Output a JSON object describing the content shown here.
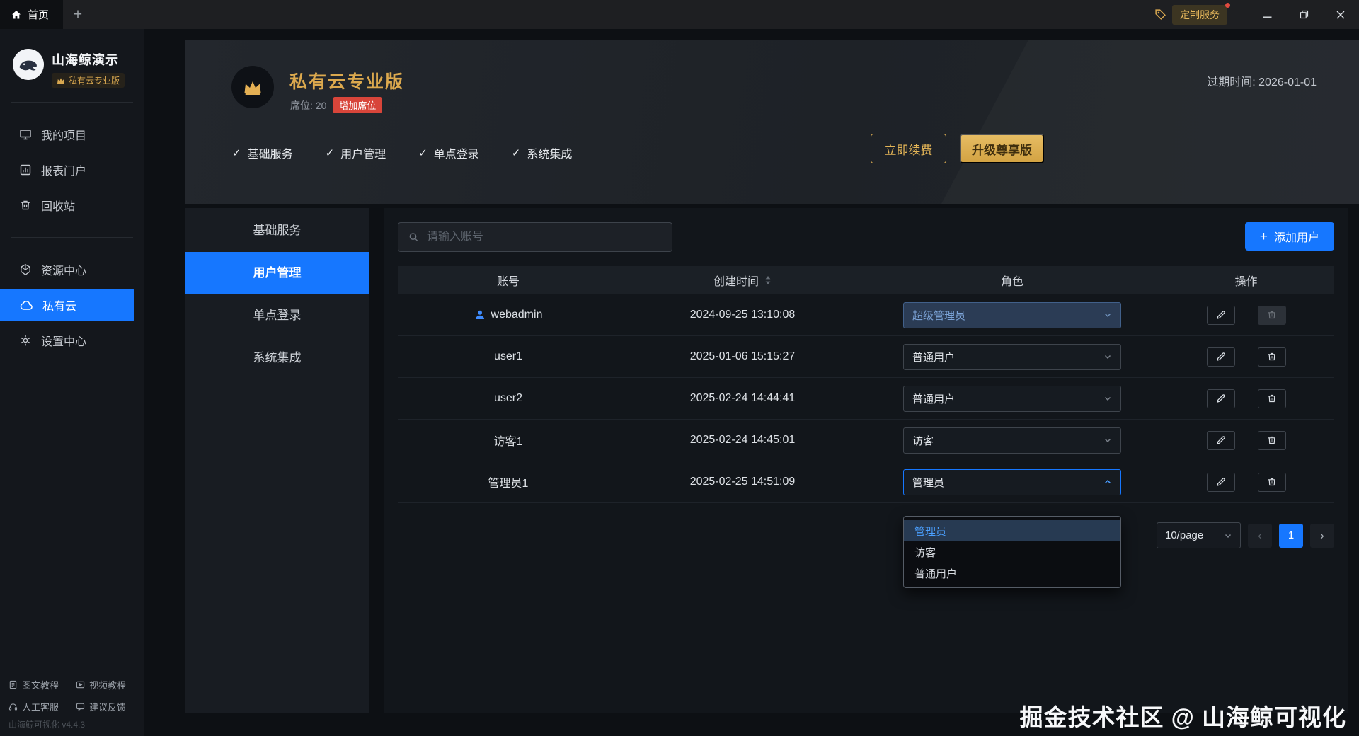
{
  "titlebar": {
    "home_tab": "首页",
    "new_tab": "+",
    "custom_service": "定制服务"
  },
  "sidebar": {
    "workspace_name": "山海鲸演示",
    "license_badge": "私有云专业版",
    "primary_menu": [
      {
        "label": "我的项目",
        "icon": "projects-icon"
      },
      {
        "label": "报表门户",
        "icon": "report-portal-icon"
      },
      {
        "label": "回收站",
        "icon": "recycle-bin-icon"
      }
    ],
    "secondary_menu": [
      {
        "label": "资源中心",
        "icon": "resource-center-icon",
        "active": false
      },
      {
        "label": "私有云",
        "icon": "private-cloud-icon",
        "active": true
      },
      {
        "label": "设置中心",
        "icon": "settings-center-icon",
        "active": false
      }
    ],
    "footer_links": [
      {
        "label": "图文教程",
        "icon": "doc-tutorial-icon"
      },
      {
        "label": "视频教程",
        "icon": "video-tutorial-icon"
      },
      {
        "label": "人工客服",
        "icon": "support-icon"
      },
      {
        "label": "建议反馈",
        "icon": "feedback-icon"
      }
    ],
    "version": "山海鲸可视化 v4.4.3"
  },
  "license_card": {
    "title": "私有云专业版",
    "seats_label": "席位: 20",
    "add_seats_button": "增加席位",
    "check": "✓",
    "features": [
      "基础服务",
      "用户管理",
      "单点登录",
      "系统集成"
    ],
    "expire_label": "过期时间: 2026-01-01",
    "renew_button": "立即续费",
    "upgrade_button": "升级尊享版"
  },
  "subnav": {
    "items": [
      "基础服务",
      "用户管理",
      "单点登录",
      "系统集成"
    ],
    "active": "用户管理"
  },
  "user_panel": {
    "search_placeholder": "请输入账号",
    "add_user_plus": "+",
    "add_user_button": "添加用户",
    "table": {
      "headers": [
        "账号",
        "创建时间",
        "角色",
        "操作"
      ],
      "rows": [
        {
          "account": "webadmin",
          "created": "2024-09-25 13:10:08",
          "role": "超级管理员",
          "role_disabled": true
        },
        {
          "account": "user1",
          "created": "2025-01-06 15:15:27",
          "role": "普通用户"
        },
        {
          "account": "user2",
          "created": "2025-02-24 14:44:41",
          "role": "普通用户"
        },
        {
          "account": "访客1",
          "created": "2025-02-24 14:45:01",
          "role": "访客"
        },
        {
          "account": "管理员1",
          "created": "2025-02-25 14:51:09",
          "role": "管理员",
          "role_open": true
        }
      ]
    },
    "role_dropdown": {
      "options": [
        "管理员",
        "访客",
        "普通用户"
      ],
      "selected": "管理员"
    },
    "pagination": {
      "page_size": "10/page",
      "prev": "‹",
      "current_page": "1",
      "next": "›"
    }
  },
  "watermark": "掘金技术社区 @ 山海鲸可视化",
  "colors": {
    "accent_blue": "#1677ff",
    "accent_gold": "#dca94e",
    "danger_red": "#d8453a"
  }
}
